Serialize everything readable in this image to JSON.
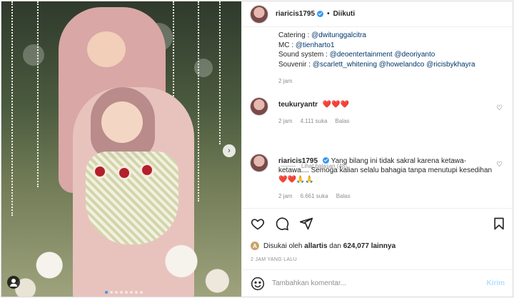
{
  "post": {
    "username": "riaricis1795",
    "separator": "•",
    "follow_status": "Diikuti",
    "caption_lines": [
      {
        "label": "Catering : ",
        "links": [
          "@dwitunggalcitra"
        ]
      },
      {
        "label": "MC : ",
        "links": [
          "@tienharto1"
        ]
      },
      {
        "label": "Sound system : ",
        "links": [
          "@deoentertainment",
          "@deoriyanto"
        ]
      },
      {
        "label": "Souvenir : ",
        "links": [
          "@scarlett_whitening",
          "@howelandco",
          "@ricisbykhayra"
        ]
      }
    ],
    "caption_time": "2 jam",
    "comments": [
      {
        "user": "teukuryantr",
        "text_emoji": "❤️❤️❤️",
        "time": "2 jam",
        "likes": "4.111 suka",
        "reply": "Balas",
        "view_replies": "Lihat balasan (48)"
      },
      {
        "user": "riaricis1795",
        "text": "Yang bilang ini tidak sakral karena ketawa-ketawa.... Semoga kalian selalu bahagia tanpa menutupi kesedihan",
        "text_emoji": "❤️❤️🙏🙏",
        "time": "2 jam",
        "likes": "6.661 suka",
        "reply": "Balas"
      }
    ],
    "liked_by_prefix": "Disukai oleh",
    "liked_by_user": "allartis",
    "liked_by_middle": "dan",
    "liked_by_count": "624,077 lainnya",
    "posted_time": "2 JAM YANG LALU",
    "comment_placeholder": "Tambahkan komentar...",
    "post_button": "Kirim"
  },
  "icons": {
    "like": "heart-icon",
    "comment": "comment-icon",
    "share": "share-icon",
    "save": "bookmark-icon",
    "emoji": "emoji-icon",
    "next": "chevron-right-icon",
    "tag": "user-tag-icon"
  },
  "colors": {
    "link": "#00376b",
    "verified": "#3897f0",
    "muted": "#8e8e8e",
    "post_button_disabled": "#b2dffc"
  }
}
